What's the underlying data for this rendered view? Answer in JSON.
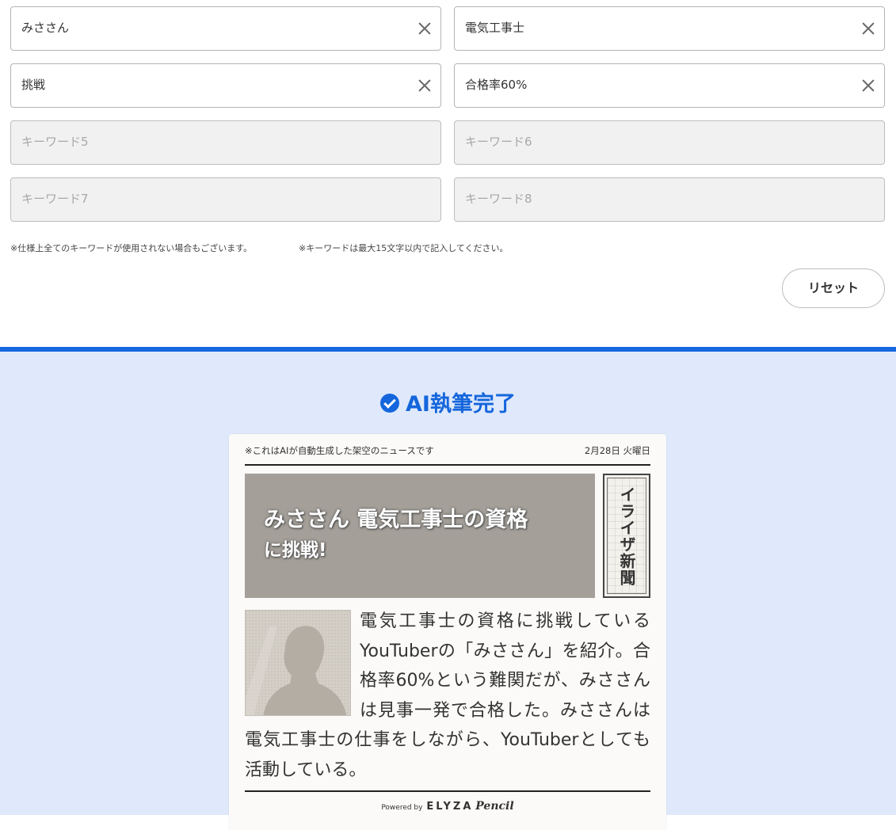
{
  "keywords": [
    {
      "value": "みささん",
      "placeholder": ""
    },
    {
      "value": "電気工事士",
      "placeholder": ""
    },
    {
      "value": "挑戦",
      "placeholder": ""
    },
    {
      "value": "合格率60%",
      "placeholder": ""
    },
    {
      "value": "",
      "placeholder": "キーワード5"
    },
    {
      "value": "",
      "placeholder": "キーワード6"
    },
    {
      "value": "",
      "placeholder": "キーワード7"
    },
    {
      "value": "",
      "placeholder": "キーワード8"
    }
  ],
  "notes": {
    "note1": "※仕様上全てのキーワードが使用されない場合もございます。",
    "note2": "※キーワードは最大15文字以内で記入してください。"
  },
  "reset_label": "リセット",
  "result": {
    "title": "AI執筆完了",
    "colors": {
      "accent": "#1566dc",
      "background": "#dfe9fb"
    },
    "article": {
      "disclaimer": "※これはAIが自動生成した架空のニュースです",
      "date": "2月28日 火曜日",
      "headline_line1": "みささん 電気工事士の資格",
      "headline_line2": "に挑戦!",
      "masthead": "イライザ新聞",
      "body": "電気工事士の資格に挑戦しているYouTuberの「みささん」を紹介。合格率60%という難関だが、みささんは見事一発で合格した。みささんは電気工事士の仕事をしながら、YouTuberとしても活動している。",
      "powered_by": "Powered by",
      "brand": "ELYZA",
      "brand_product": "Pencil"
    }
  }
}
